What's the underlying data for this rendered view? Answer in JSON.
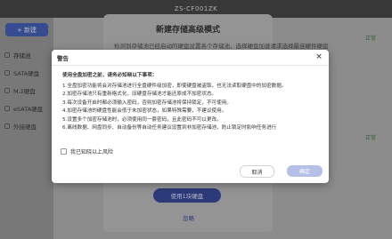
{
  "window": {
    "title": "ZS-CF001ZK"
  },
  "sidebar": {
    "new_button": "+ 新建",
    "items": [
      {
        "label": "存储池",
        "icon": "storage-pool-icon"
      },
      {
        "label": "SATA硬盘",
        "icon": "disk-icon"
      },
      {
        "label": "M.2硬盘",
        "icon": "disk-icon"
      },
      {
        "label": "eSATA硬盘",
        "icon": "disk-icon"
      },
      {
        "label": "外接硬盘",
        "icon": "disk-icon"
      }
    ]
  },
  "background": {
    "panel_title": "新建存储高级模式",
    "panel_subtitle": "检测到存储池已经启动的硬盘设置各个存储池，选择硬盘加速请求选择最佳硬件硬盘",
    "green_labels": [
      "正常",
      "正常"
    ],
    "use_button": "使用1块硬盘",
    "ignore_link": "忽略"
  },
  "dialog": {
    "title": "警告",
    "heading": "使用全盘加密之前，请务必知晓以下事项：",
    "items": [
      "1.全盘加密功能将会对存储池进行全盘硬件级加密，即使硬盘被盗取，也无法读取硬盘中的加密数据。",
      "2.加密存储池只有重新格式化，旧硬盘存储池才能还原成不加密状态。",
      "3.每次设备开启时都必须输入密码，否则加密存储池将保持锁定，不可使用。",
      "4.加密存储池的硬盘性能会低于未加密状态，如果特殊需要，不建议使用。",
      "5.设置多个加密存储池时，必须使用同一套密码，且此密码不可以更改。",
      "6.离线数据、网盘同步、自动备份等自动任务建议设置到非加密存储池，防止锁定时影响任务进行"
    ],
    "checkbox_label": "我已知晓以上风险",
    "cancel_label": "取消",
    "ok_label": "确定"
  },
  "colors": {
    "accent": "#3b54a8",
    "ok_button_disabled": "#b6c0e7",
    "status_green": "#2e6b38"
  }
}
